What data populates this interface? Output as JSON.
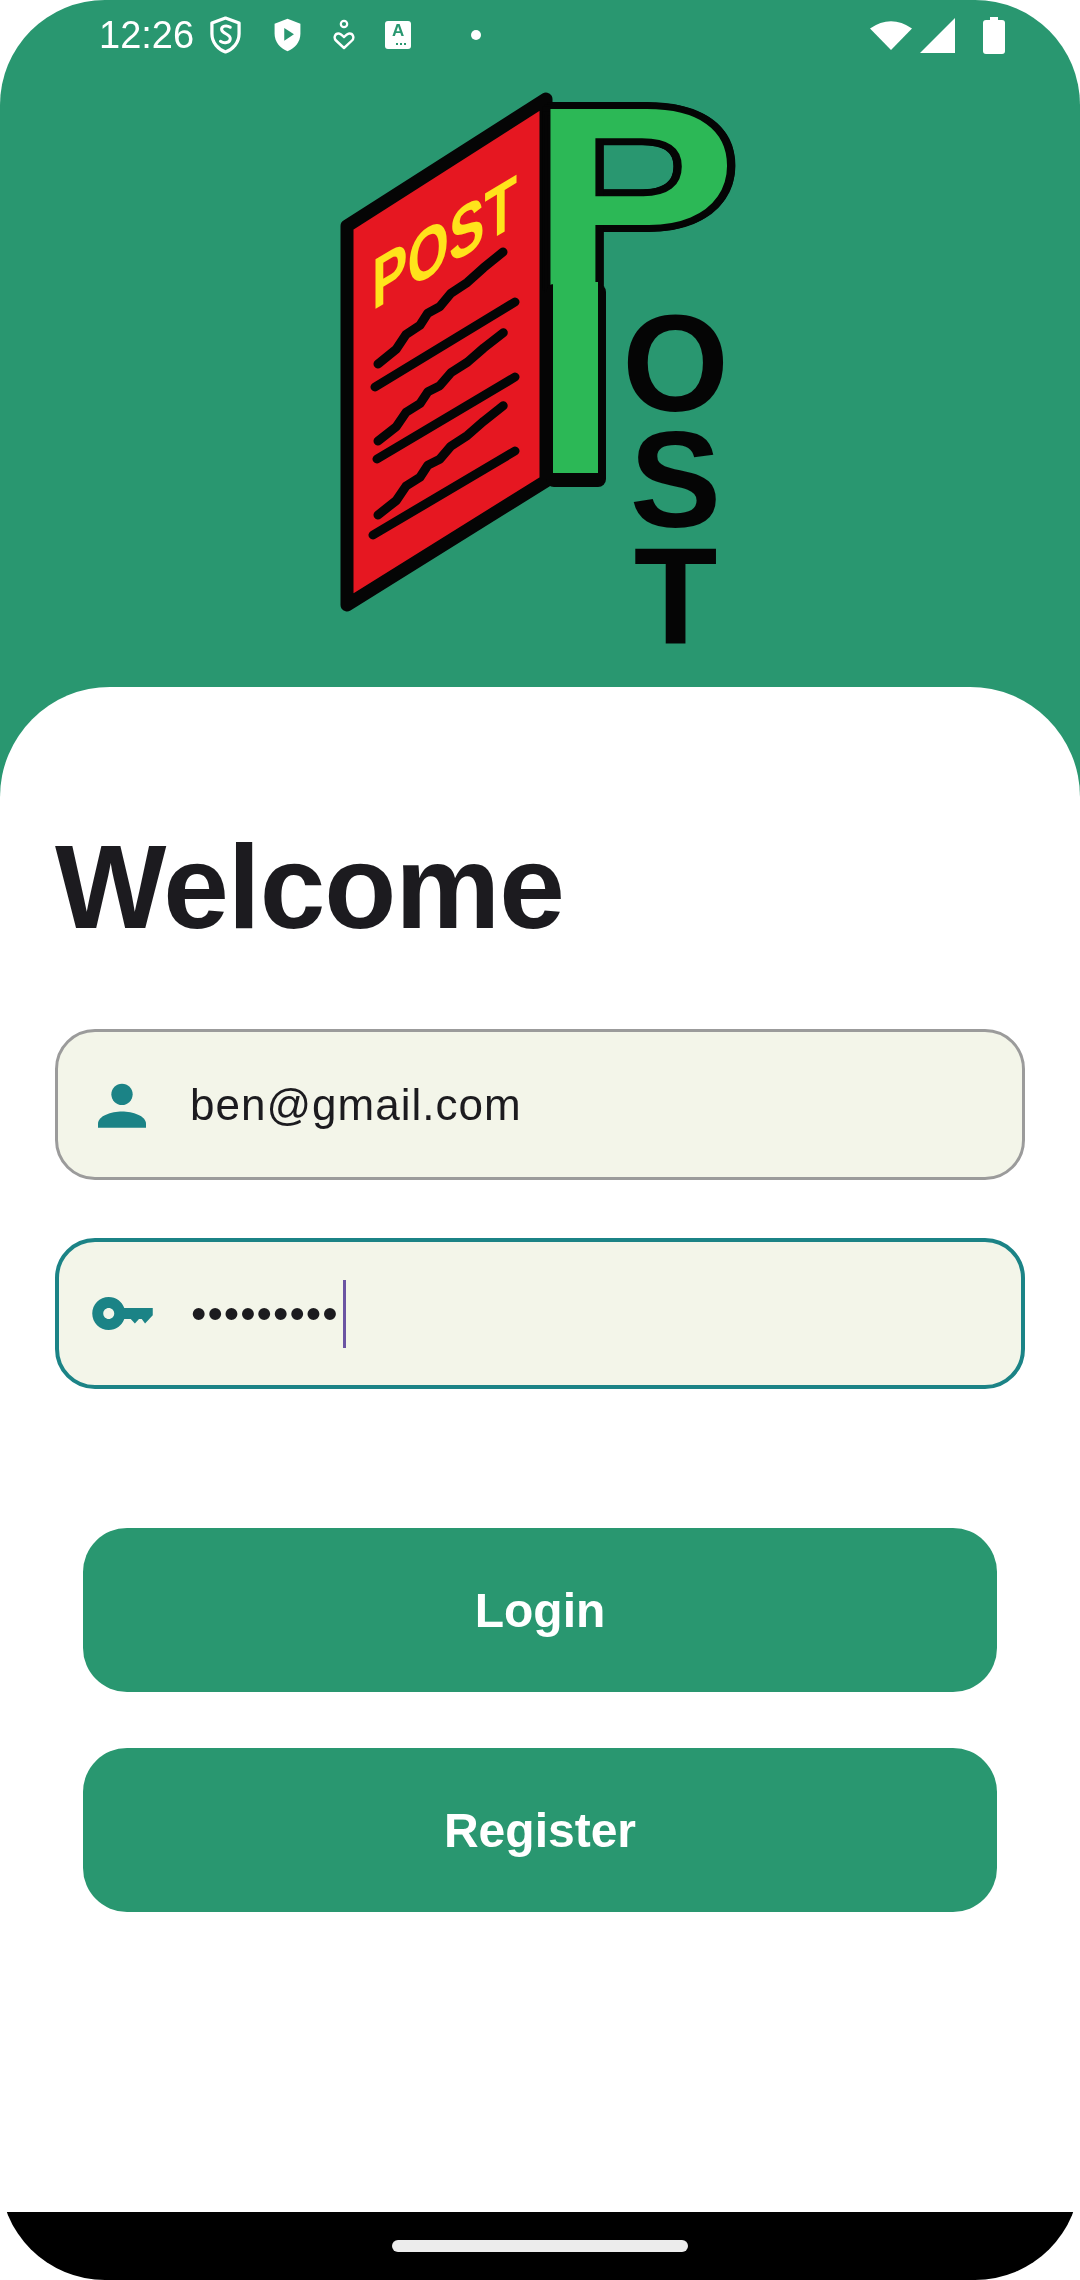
{
  "status_bar": {
    "time": "12:26",
    "notification_letter": "A"
  },
  "logo": {
    "label": "POST",
    "initial": "P",
    "stacked_letters": "OST"
  },
  "heading": "Welcome",
  "fields": [
    {
      "kind": "email",
      "value": "ben@gmail.com",
      "focused": false
    },
    {
      "kind": "password",
      "value": "•••••••••",
      "focused": true
    }
  ],
  "buttons": [
    "Login",
    "Register"
  ]
}
